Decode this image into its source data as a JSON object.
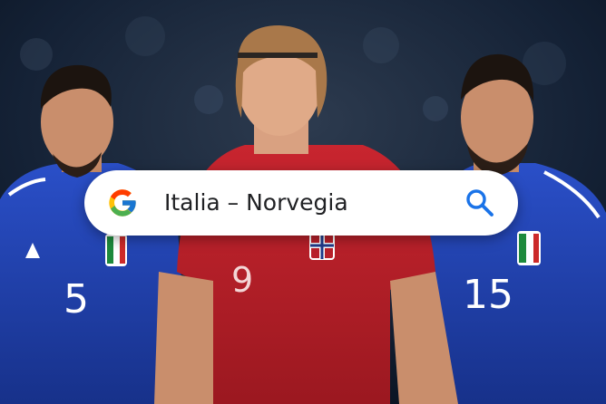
{
  "search": {
    "query": "Italia – Norvegia",
    "icon": "search-icon",
    "logo": "google-g-logo",
    "icon_color": "#1a73e8"
  },
  "photo": {
    "players": [
      {
        "team": "Italy",
        "shirt_number": "5",
        "kit_color": "#1f3fa8"
      },
      {
        "team": "Norway",
        "shirt_number": "9",
        "kit_color": "#b8202a"
      },
      {
        "team": "Italy",
        "shirt_number": "15",
        "kit_color": "#1f3fa8"
      }
    ]
  }
}
